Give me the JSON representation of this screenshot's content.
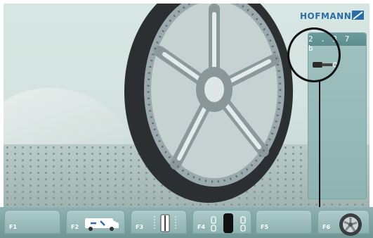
{
  "brand": {
    "name": "HOFMANN"
  },
  "status_panel": {
    "code": "2 . 3 7 b",
    "icon": "valve-icon"
  },
  "function_keys": [
    {
      "label": "F1",
      "icon": ""
    },
    {
      "label": "F2",
      "icon": "service-van-icon"
    },
    {
      "label": "F3",
      "icon": "wheel-profile-icon"
    },
    {
      "label": "F4",
      "icon": "weight-positions-icon"
    },
    {
      "label": "F5",
      "icon": ""
    },
    {
      "label": "F6",
      "icon": "wheel-icon"
    }
  ],
  "colors": {
    "panel": "#8fb4b4",
    "logo": "#2b6ea6",
    "callout": "#111111"
  }
}
